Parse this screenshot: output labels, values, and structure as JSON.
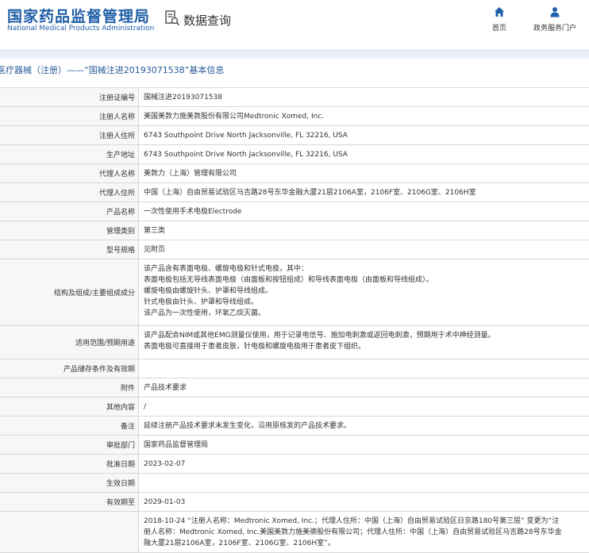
{
  "header": {
    "logo_cn": "国家药品监督管理局",
    "logo_en": "National Medical Products Administration",
    "data_query": "数据查询",
    "nav_home": "首页",
    "nav_portal": "政务服务门户"
  },
  "page_title": "医疗器械（注册）——“国械注进20193071538”基本信息",
  "rows": [
    {
      "label": "注册证编号",
      "value": "国械注进20193071538"
    },
    {
      "label": "注册人名称",
      "value": "美国美敦力施美敦股份有限公司Medtronic Xomed, Inc."
    },
    {
      "label": "注册人住所",
      "value": "6743 Southpoint Drive North Jacksonville, FL 32216, USA"
    },
    {
      "label": "生产地址",
      "value": "6743 Southpoint Drive North Jacksonville, FL 32216, USA"
    },
    {
      "label": "代理人名称",
      "value": "美敦力（上海）管理有限公司"
    },
    {
      "label": "代理人住所",
      "value": "中国（上海）自由贸易试验区马吉路28号东华金融大厦21层2106A室，2106F室、2106G室、2106H室"
    },
    {
      "label": "产品名称",
      "value": "一次性使用手术电极Electrode"
    },
    {
      "label": "管理类别",
      "value": "第三类"
    },
    {
      "label": "型号规格",
      "value": "见附页"
    },
    {
      "label": "结构及组成/主要组成成分",
      "lines": [
        "该产品含有表面电极、螺旋电极和针式电极，其中：",
        "表面电极包括无导线表面电极（由面板和按钮组成）和导线表面电极（由面板和导线组成）。",
        "螺旋电极由螺旋针头、护罩和导线组成。",
        "针式电极由针头、护罩和导线组成。",
        "该产品为一次性使用，环氧乙烷灭菌。"
      ]
    },
    {
      "label": "适用范围/预期用途",
      "lines": [
        "该产品配合NIM或其他EMG测量仪使用，用于记录电信号、施加电刺激或返回电刺激，预期用于术中神经测量。",
        "表面电极可直接用于患者皮肤，针电极和螺旋电极用于患者皮下组织。"
      ]
    },
    {
      "label": "产品储存条件及有效期",
      "value": ""
    },
    {
      "label": "附件",
      "value": "产品技术要求"
    },
    {
      "label": "其他内容",
      "value": "/"
    },
    {
      "label": "备注",
      "value": "延续注册产品技术要求未发生变化，沿用原核发的产品技术要求。"
    },
    {
      "label": "审批部门",
      "value": "国家药品监督管理局"
    },
    {
      "label": "批准日期",
      "value": "2023-02-07"
    },
    {
      "label": "生效日期",
      "value": ""
    },
    {
      "label": "有效期至",
      "value": "2029-01-03"
    },
    {
      "label": "",
      "lines": [
        "2018-10-24 “注册人名称：Medtronic Xomed, Inc.；代理人住所：中国（上海）自由贸易试验区日京路180号第三层” 变更为“注",
        "册人名称：Medtronic Xomed, Inc.美国美敦力施美德股份有限公司；代理人住所：中国（上海）自由贸易试验区马吉路28号东华金",
        "融大厦21层2106A室，2106F室、2106G室、2106H室”。"
      ]
    }
  ]
}
